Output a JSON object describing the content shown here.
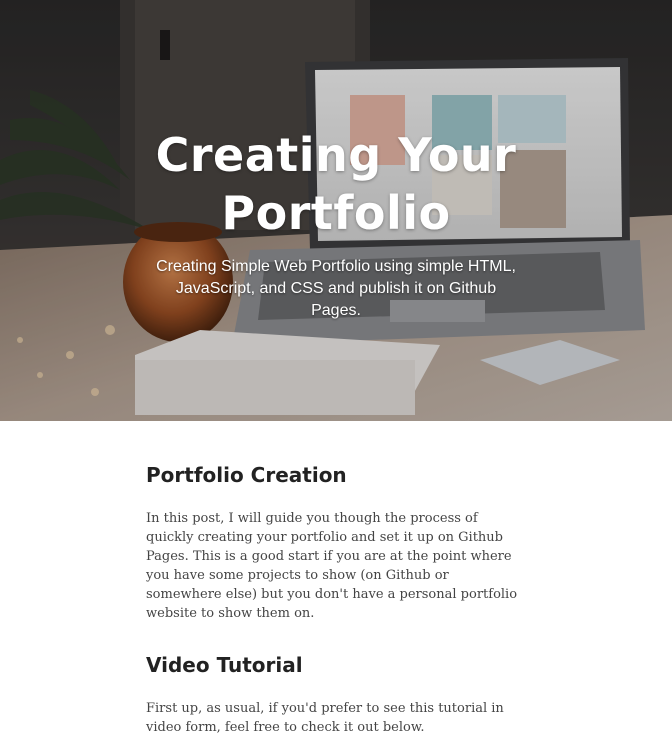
{
  "hero": {
    "title": "Creating Your Portfolio",
    "subtitle": "Creating Simple Web Portfolio using simple HTML, JavaScript, and CSS and publish it on Github Pages.",
    "background_description": "laptop-on-desk-photo"
  },
  "article": {
    "section1": {
      "heading": "Portfolio Creation",
      "paragraph": "In this post, I will guide you though the process of quickly creating your portfolio and set it up on Github Pages. This is a good start if you are at the point where you have some projects to show (on Github or somewhere else) but you don't have a personal portfolio website to show them on."
    },
    "section2": {
      "heading": "Video Tutorial",
      "paragraph": "First up, as usual, if you'd prefer to see this tutorial in video form, feel free to check it out below."
    }
  },
  "colors": {
    "hero_text": "#ffffff",
    "heading": "#222222",
    "body_text": "#444444"
  }
}
